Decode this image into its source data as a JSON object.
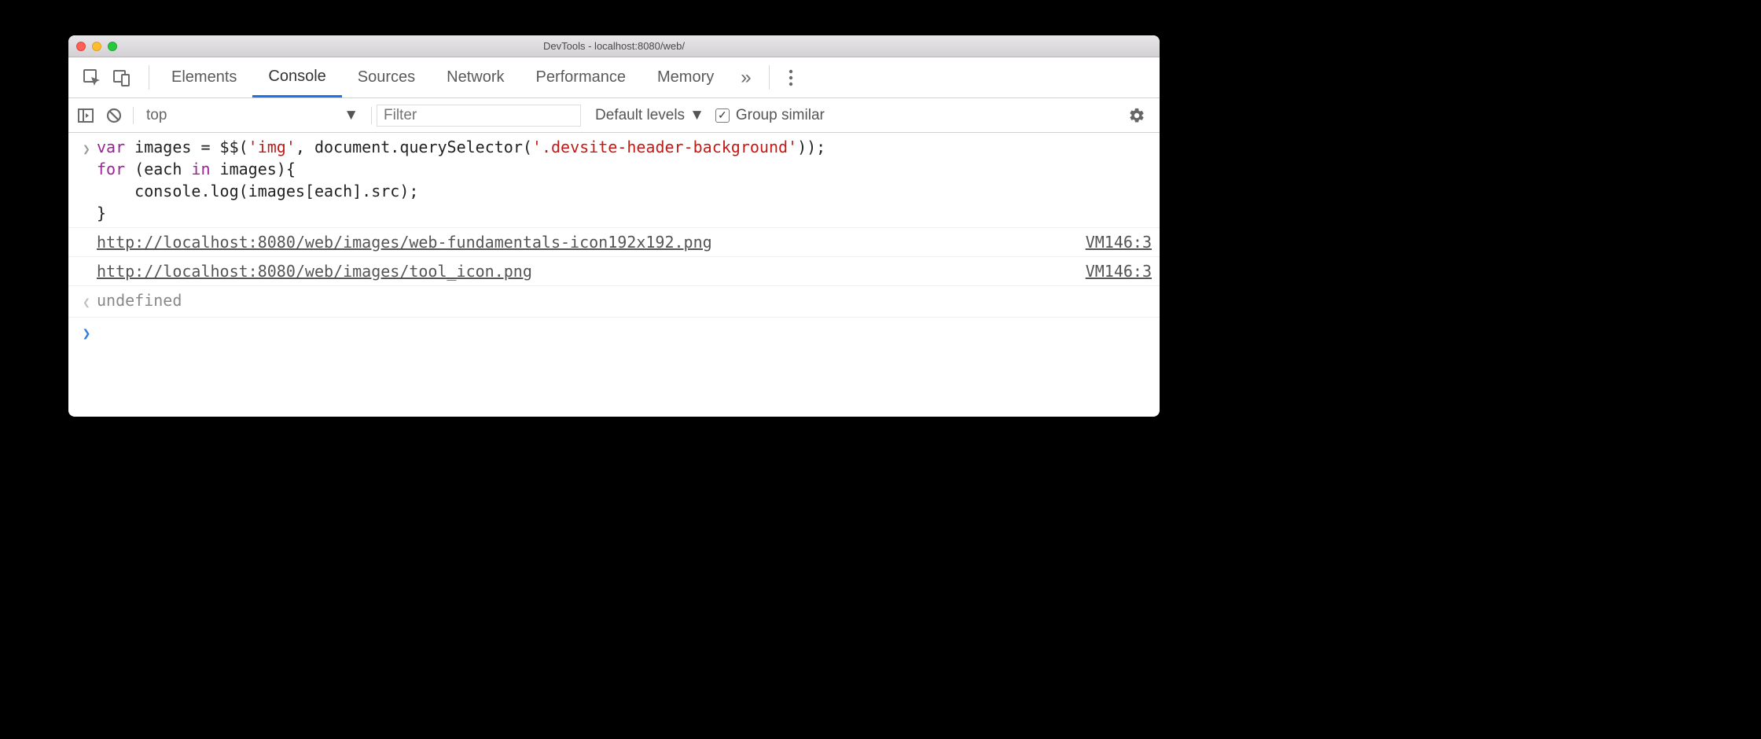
{
  "window": {
    "title": "DevTools - localhost:8080/web/"
  },
  "tabs": {
    "items": [
      "Elements",
      "Console",
      "Sources",
      "Network",
      "Performance",
      "Memory"
    ],
    "active_index": 1,
    "overflow_glyph": "»"
  },
  "toolbar": {
    "context": "top",
    "filter_placeholder": "Filter",
    "levels_label": "Default levels",
    "group_similar_label": "Group similar",
    "group_similar_checked": true
  },
  "console": {
    "input_code": {
      "l1_kw1": "var",
      "l1_id": " images ",
      "l1_op": "=",
      "l1_fn": " $$(",
      "l1_str1": "'img'",
      "l1_comma": ", document.querySelector(",
      "l1_str2": "'.devsite-header-background'",
      "l1_end": "));",
      "l2_kw1": "for",
      "l2_a": " (each ",
      "l2_kw2": "in",
      "l2_b": " images){",
      "l3": "    console.log(images[each].src);",
      "l4": "}"
    },
    "logs": [
      {
        "text": "http://localhost:8080/web/images/web-fundamentals-icon192x192.png",
        "source": "VM146:3"
      },
      {
        "text": "http://localhost:8080/web/images/tool_icon.png",
        "source": "VM146:3"
      }
    ],
    "result": "undefined"
  }
}
